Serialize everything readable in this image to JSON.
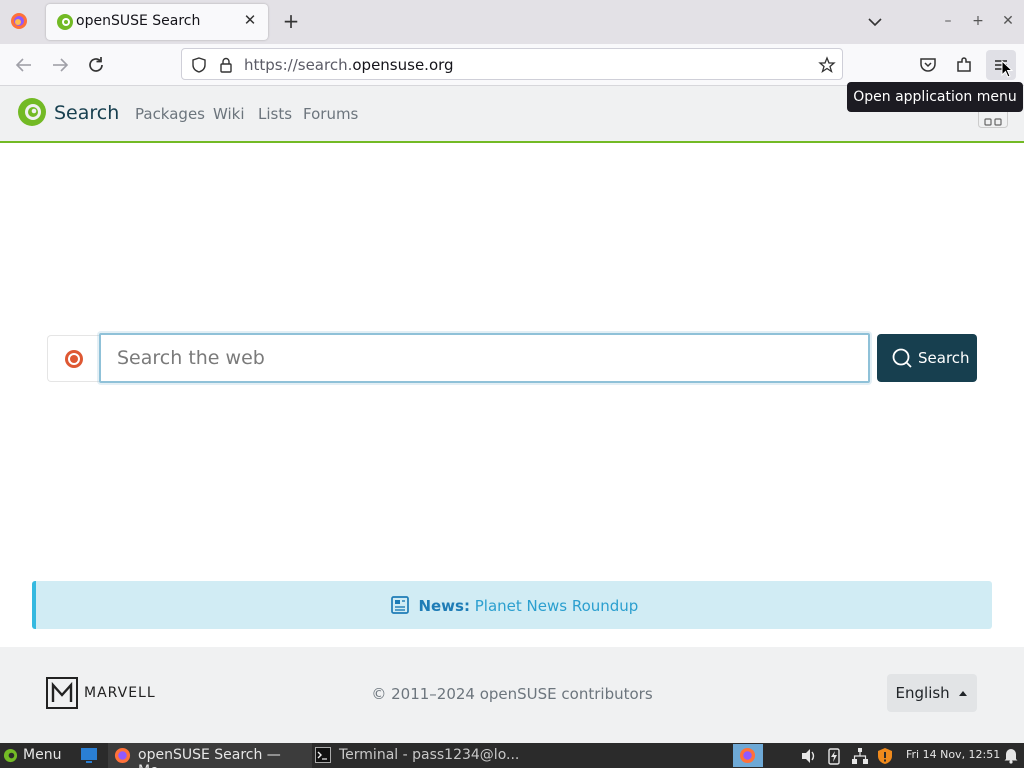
{
  "browser": {
    "tab_title": "openSUSE Search",
    "tab_close": "✕",
    "new_tab": "+",
    "url_prefix": "https://search.",
    "url_domain": "opensuse.org",
    "tooltip": "Open application menu",
    "window_controls": {
      "minimize": "–",
      "maximize": "+",
      "close": "✕"
    }
  },
  "site": {
    "brand": "Search",
    "nav": [
      "Packages",
      "Wiki",
      "Lists",
      "Forums"
    ],
    "search": {
      "placeholder": "Search the web",
      "button_label": "Search"
    },
    "news": {
      "label": "News:",
      "link": "Planet News Roundup"
    },
    "footer": {
      "logo_text": "MARVELL",
      "copyright": "© 2011–2024 openSUSE contributors",
      "language": "English"
    }
  },
  "taskbar": {
    "menu": "Menu",
    "firefox_task": "openSUSE Search — Mo...",
    "terminal_task": "Terminal - pass1234@lo...",
    "clock": "Fri 14 Nov, 12:51"
  },
  "colors": {
    "brand_green": "#73ba25",
    "brand_dark": "#173f4f",
    "news_bg": "#d1ecf4",
    "news_accent": "#35b9e0"
  }
}
